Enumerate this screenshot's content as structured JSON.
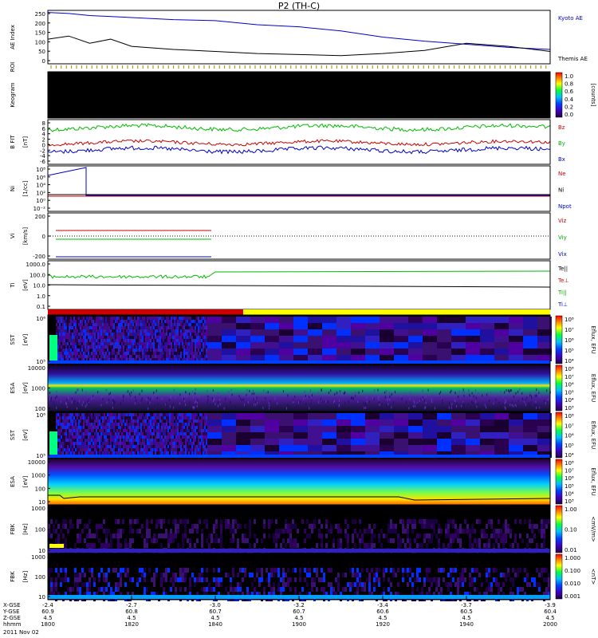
{
  "title": "P2 (TH-C)",
  "time_axis": {
    "rows": [
      {
        "label": "X-GSE",
        "values": [
          "-2.4",
          "-2.7",
          "-3.0",
          "-3.2",
          "-3.4",
          "-3.7",
          "-3.9"
        ]
      },
      {
        "label": "Y-GSE",
        "values": [
          "60.9",
          "60.8",
          "60.7",
          "60.7",
          "60.6",
          "60.5",
          "60.4"
        ]
      },
      {
        "label": "Z-GSE",
        "values": [
          "4.5",
          "4.5",
          "4.5",
          "4.5",
          "4.5",
          "4.5",
          "4.5"
        ]
      },
      {
        "label": "hhmm",
        "values": [
          "1800",
          "1820",
          "1840",
          "1900",
          "1920",
          "1940",
          "2000"
        ]
      }
    ],
    "date": "2011 Nov 02"
  },
  "panels": [
    {
      "id": "ae",
      "ylabel": "AE Index",
      "yticks": [
        "250",
        "200",
        "150",
        "100",
        "50",
        "0"
      ],
      "legend": [
        {
          "text": "Kyoto AE",
          "color": "#0000cc"
        },
        {
          "text": "Themis AE",
          "color": "#000000"
        }
      ]
    },
    {
      "id": "roi",
      "ylabel": "ROI"
    },
    {
      "id": "keogram",
      "ylabel": "Keogram",
      "bar_ticks": [
        "1.0",
        "0.8",
        "0.6",
        "0.4",
        "0.2",
        "0.0"
      ],
      "bar_label": "[counts]"
    },
    {
      "id": "bfield",
      "ylabel": "B FIT",
      "ylabel2": "[nT]",
      "yticks": [
        "8",
        "6",
        "4",
        "2",
        "0",
        "-2",
        "-4",
        "-6"
      ],
      "legend": [
        {
          "text": "Bz",
          "color": "#cc0000"
        },
        {
          "text": "By",
          "color": "#00aa00"
        },
        {
          "text": "Bx",
          "color": "#0000cc"
        }
      ]
    },
    {
      "id": "density",
      "ylabel": "Ni",
      "ylabel2": "[1/cc]",
      "yticks": [
        "10⁸",
        "10⁶",
        "10⁴",
        "10²",
        "10⁰",
        "10⁻²"
      ],
      "legend": [
        {
          "text": "Ne",
          "color": "#cc0000"
        },
        {
          "text": "Ni",
          "color": "#000000"
        },
        {
          "text": "Npot",
          "color": "#0000cc"
        }
      ]
    },
    {
      "id": "velocity",
      "ylabel": "Vi",
      "ylabel2": "[km/s]",
      "yticks": [
        "200",
        "0",
        "-200"
      ],
      "legend": [
        {
          "text": "Viz",
          "color": "#cc0000"
        },
        {
          "text": "Viy",
          "color": "#00aa00"
        },
        {
          "text": "Vix",
          "color": "#0000cc"
        }
      ]
    },
    {
      "id": "temp",
      "ylabel": "Ti",
      "ylabel2": "[eV]",
      "yticks": [
        "1000.0",
        "100.0",
        "10.0",
        "1.0",
        "0.1"
      ],
      "legend": [
        {
          "text": "Te||",
          "color": "#000000"
        },
        {
          "text": "Te⊥",
          "color": "#cc0000"
        },
        {
          "text": "Ti||",
          "color": "#00aa00"
        },
        {
          "text": "Ti⊥",
          "color": "#0000cc"
        }
      ]
    },
    {
      "id": "mode",
      "ylabel": ""
    },
    {
      "id": "sst_e",
      "ylabel": "SST",
      "ylabel2": "[eV]",
      "yticks": [
        "10⁶",
        "10⁵"
      ],
      "bar_ticks": [
        "10⁸",
        "10⁷",
        "10⁶",
        "10⁵",
        "10⁴"
      ],
      "bar_label": "Eflux, EFU"
    },
    {
      "id": "esa_e",
      "ylabel": "ESA",
      "ylabel2": "[eV]",
      "yticks": [
        "10000",
        "1000",
        "100"
      ],
      "bar_ticks": [
        "10⁸",
        "10⁷",
        "10⁶",
        "10⁵",
        "10⁴",
        "10³"
      ],
      "bar_label": "Eflux, EFU"
    },
    {
      "id": "sst_i",
      "ylabel": "SST",
      "ylabel2": "[eV]",
      "yticks": [
        "10⁶",
        "10⁵"
      ],
      "bar_ticks": [
        "10⁸",
        "10⁷",
        "10⁶",
        "10⁵",
        "10⁴"
      ],
      "bar_label": "Eflux, EFU"
    },
    {
      "id": "esa_i",
      "ylabel": "ESA",
      "ylabel2": "[eV]",
      "yticks": [
        "10000",
        "1000",
        "100",
        "10"
      ],
      "bar_ticks": [
        "10⁸",
        "10⁷",
        "10⁶",
        "10⁵",
        "10⁴",
        "10³"
      ],
      "bar_label": "Eflux, EFU"
    },
    {
      "id": "fbk_e",
      "ylabel": "FBK",
      "ylabel2": "[Hz]",
      "yticks": [
        "1000",
        "100",
        "10"
      ],
      "bar_ticks": [
        "1.00",
        "0.10",
        "0.01"
      ],
      "bar_label": "<mV/m>"
    },
    {
      "id": "fbk_b",
      "ylabel": "FBK",
      "ylabel2": "[Hz]",
      "yticks": [
        "1000",
        "100",
        "10"
      ],
      "bar_ticks": [
        "1.000",
        "0.100",
        "0.010",
        "0.001"
      ],
      "bar_label": "<nT>"
    }
  ],
  "chart_data": {
    "type": "line",
    "title": "P2 (TH-C)",
    "x_range": [
      "18:00",
      "20:00"
    ],
    "x_ticks": [
      "1800",
      "1820",
      "1840",
      "1900",
      "1920",
      "1940",
      "2000"
    ],
    "series": [
      {
        "name": "Kyoto AE",
        "panel": "AE Index",
        "x_hhmm": [
          "1800",
          "1805",
          "1810",
          "1820",
          "1830",
          "1840",
          "1850",
          "1900",
          "1910",
          "1920",
          "1930",
          "1940",
          "1950",
          "2000"
        ],
        "values": [
          250,
          245,
          235,
          225,
          215,
          210,
          190,
          180,
          160,
          130,
          110,
          95,
          80,
          70
        ]
      },
      {
        "name": "Themis AE",
        "panel": "AE Index",
        "x_hhmm": [
          "1800",
          "1805",
          "1810",
          "1815",
          "1820",
          "1830",
          "1840",
          "1850",
          "1900",
          "1910",
          "1920",
          "1930",
          "1940",
          "1950",
          "2000"
        ],
        "values": [
          120,
          135,
          100,
          120,
          85,
          70,
          60,
          50,
          45,
          40,
          50,
          65,
          100,
          85,
          60
        ]
      },
      {
        "name": "Bz",
        "panel": "B FIT",
        "values_summary": "approximately 0 to 2 nT"
      },
      {
        "name": "By",
        "panel": "B FIT",
        "values_summary": "approximately 4 to 6 nT"
      },
      {
        "name": "Bx",
        "panel": "B FIT",
        "values_summary": "approximately -2 to -4 nT"
      }
    ]
  }
}
